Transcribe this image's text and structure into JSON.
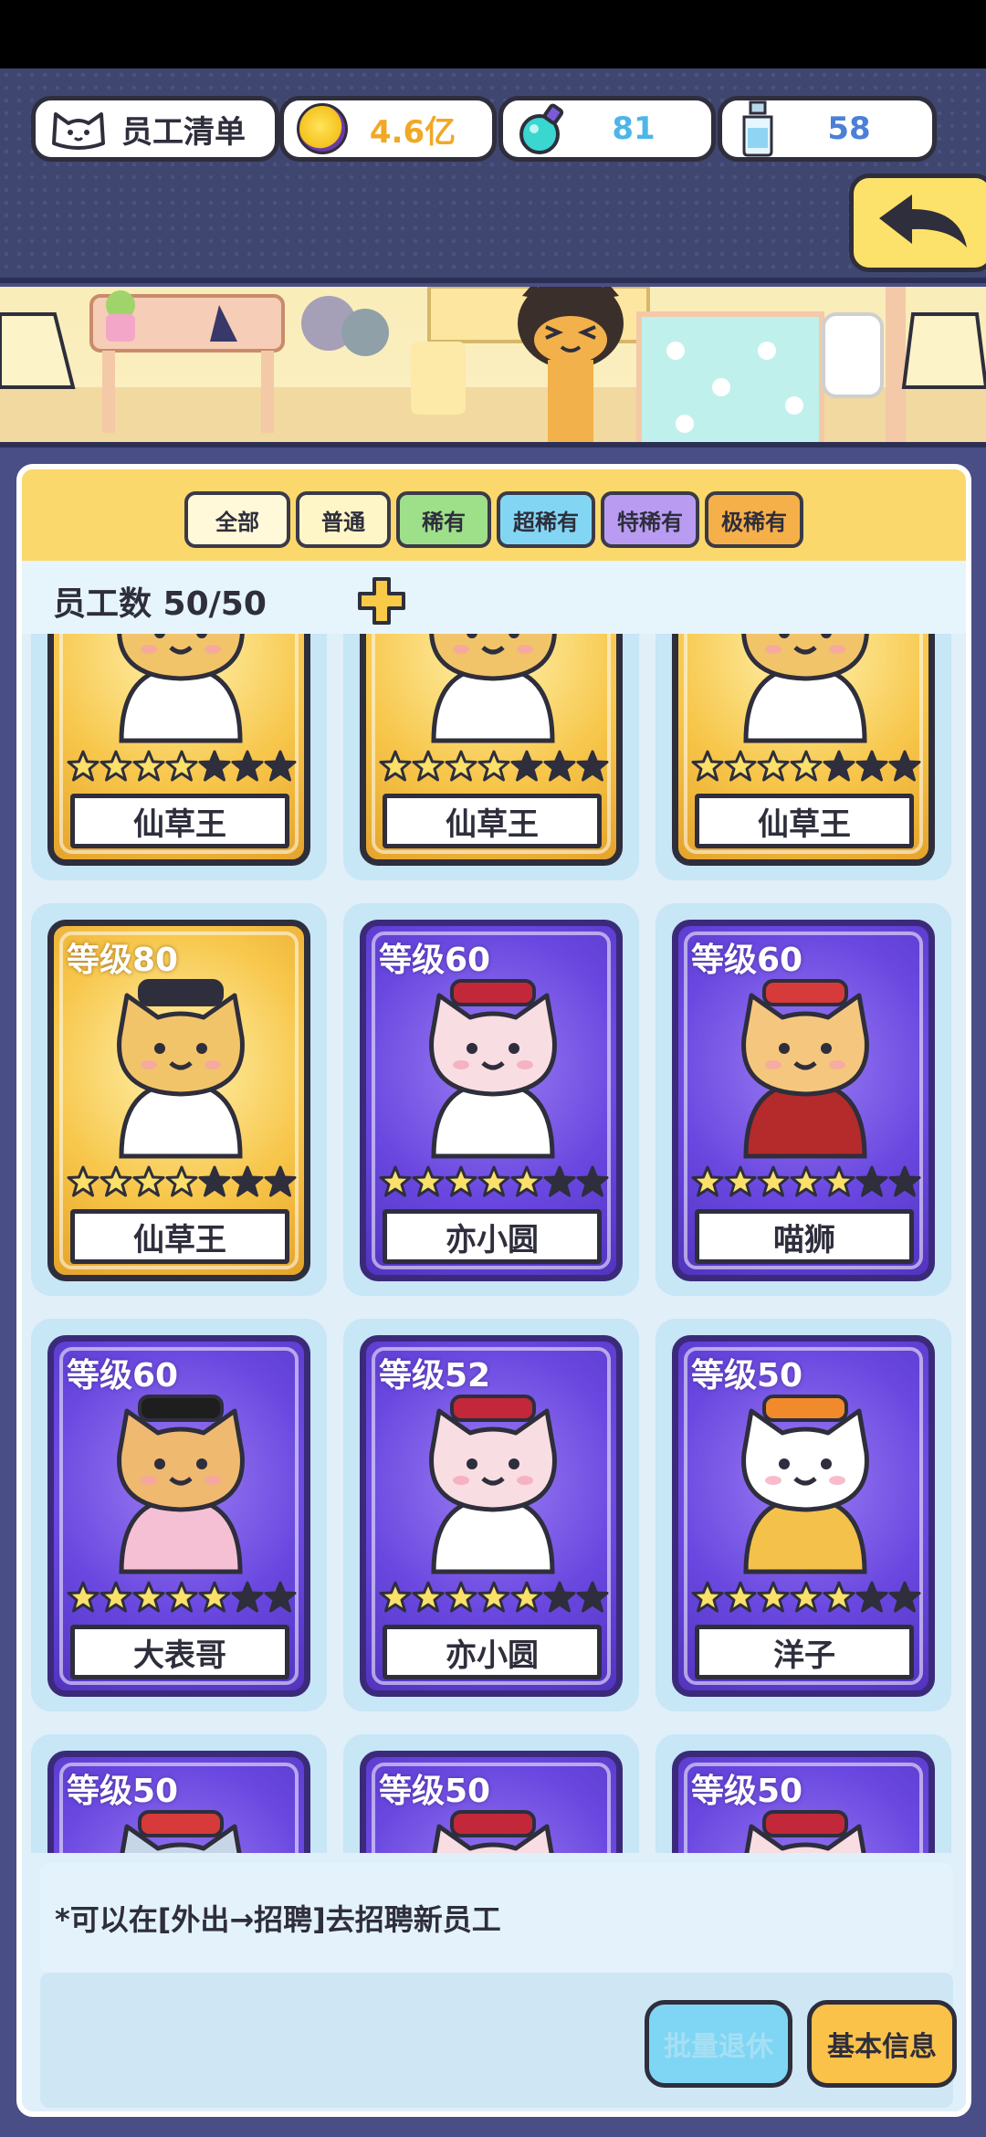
{
  "header": {
    "staff_list_label": "员工清单",
    "coins": "4.6亿",
    "potion": "81",
    "bottle": "58"
  },
  "tabs": [
    {
      "label": "全部",
      "color": "#fff9d9",
      "active": true
    },
    {
      "label": "普通",
      "color": "#fff6c8"
    },
    {
      "label": "稀有",
      "color": "#9edf8a"
    },
    {
      "label": "超稀有",
      "color": "#82d6f4"
    },
    {
      "label": "特稀有",
      "color": "#b99cf2"
    },
    {
      "label": "极稀有",
      "color": "#f6b04a"
    }
  ],
  "staff_count": {
    "label": "员工数 50/50"
  },
  "cards": [
    {
      "level": "",
      "name": "仙草王",
      "rarity": "gold",
      "stars": 4,
      "art": "sage"
    },
    {
      "level": "",
      "name": "仙草王",
      "rarity": "gold",
      "stars": 4,
      "art": "sage"
    },
    {
      "level": "",
      "name": "仙草王",
      "rarity": "gold",
      "stars": 4,
      "art": "sage"
    },
    {
      "level": "等级80",
      "name": "仙草王",
      "rarity": "gold",
      "stars": 4,
      "art": "sage"
    },
    {
      "level": "等级60",
      "name": "亦小圆",
      "rarity": "purple",
      "stars": 5,
      "art": "pink"
    },
    {
      "level": "等级60",
      "name": "喵狮",
      "rarity": "purple",
      "stars": 5,
      "art": "lion"
    },
    {
      "level": "等级60",
      "name": "大表哥",
      "rarity": "purple",
      "stars": 5,
      "art": "cool"
    },
    {
      "level": "等级52",
      "name": "亦小圆",
      "rarity": "purple",
      "stars": 5,
      "art": "pink"
    },
    {
      "level": "等级50",
      "name": "洋子",
      "rarity": "purple",
      "stars": 5,
      "art": "calico"
    },
    {
      "level": "等级50",
      "name": "",
      "rarity": "purple",
      "stars": 5,
      "art": "knight"
    },
    {
      "level": "等级50",
      "name": "",
      "rarity": "purple",
      "stars": 5,
      "art": "pink"
    },
    {
      "level": "等级50",
      "name": "",
      "rarity": "purple",
      "stars": 5,
      "art": "pink"
    }
  ],
  "hint": "*可以在[外出→招聘]去招聘新员工",
  "buttons": {
    "batch_retire": "批量退休",
    "basic_info": "基本信息"
  }
}
